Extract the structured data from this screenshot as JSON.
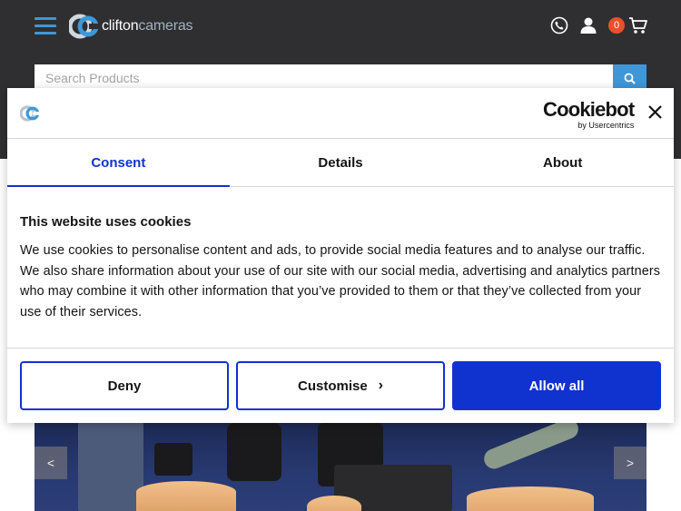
{
  "header": {
    "logo_text_a": "clifton",
    "logo_text_b": "cameras",
    "basket_count": "0",
    "search_placeholder": "Search Products",
    "icons": [
      "menu-icon",
      "phone-icon",
      "user-icon",
      "cart-icon",
      "search-icon"
    ],
    "accent_color": "#3e97d8"
  },
  "cookie_dialog": {
    "brand_name": "Cookiebot",
    "brand_sub": "by Usercentrics",
    "tabs": [
      {
        "label": "Consent",
        "active": true
      },
      {
        "label": "Details",
        "active": false
      },
      {
        "label": "About",
        "active": false
      }
    ],
    "title": "This website uses cookies",
    "body": "We use cookies to personalise content and ads, to provide social media features and to analyse our traffic. We also share information about your use of our site with our social media, advertising and analytics partners who may combine it with other information that you’ve provided to them or that they’ve collected from your use of their services.",
    "buttons": {
      "deny": "Deny",
      "customise": "Customise",
      "allow_all": "Allow all"
    },
    "primary_color": "#1032cf"
  },
  "banner": {
    "prev_label": "<",
    "next_label": ">"
  }
}
